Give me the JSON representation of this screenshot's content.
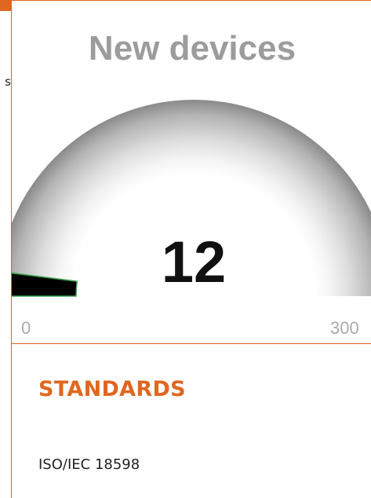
{
  "left_column": {
    "clipped_text": "s"
  },
  "gauge": {
    "title": "New devices",
    "value": 12,
    "value_label": "12",
    "min": 0,
    "max": 300,
    "min_label": "0",
    "max_label": "300",
    "fill_color": "#000000",
    "fill_edge_color": "#3aa04a"
  },
  "standards": {
    "heading": "STANDARDS",
    "items": [
      "ISO/IEC 18598"
    ]
  },
  "colors": {
    "accent": "#e0671f",
    "title_gray": "#9c9c9c",
    "label_gray": "#aaaaaa"
  }
}
